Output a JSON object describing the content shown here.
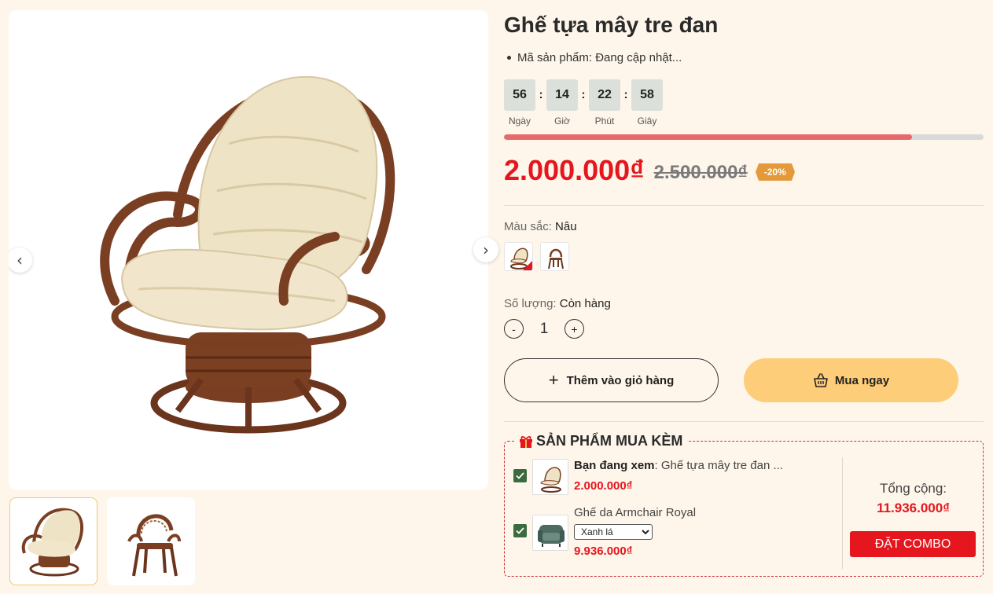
{
  "product": {
    "title": "Ghế tựa mây tre đan",
    "sku_label": "Mã sản phẩm:",
    "sku_value": "Đang cập nhật..."
  },
  "gallery": {
    "prev_icon": "chevron-left-icon",
    "next_icon": "chevron-right-icon",
    "main_image": "rattan-swivel-chair-with-cream-cushion",
    "thumbnails": [
      "rattan-swivel-chair-with-cream-cushion",
      "rattan-armchair-woven-back"
    ]
  },
  "countdown": {
    "units": [
      {
        "value": "56",
        "label": "Ngày"
      },
      {
        "value": "14",
        "label": "Giờ"
      },
      {
        "value": "22",
        "label": "Phút"
      },
      {
        "value": "58",
        "label": "Giây"
      }
    ],
    "separator": ":"
  },
  "sale_progress": 0.85,
  "price": {
    "current": "2.000.000₫",
    "original": "2.500.000₫",
    "discount": "-20%"
  },
  "color": {
    "label": "Màu sắc:",
    "value": "Nâu",
    "options": [
      "swivel-chair-swatch",
      "armchair-swatch"
    ]
  },
  "quantity": {
    "label": "Số lượng:",
    "status": "Còn hàng",
    "minus": "-",
    "value": "1",
    "plus": "+"
  },
  "actions": {
    "add_to_cart": "Thêm vào giỏ hàng",
    "add_to_cart_icon": "plus-icon",
    "buy_now": "Mua ngay",
    "buy_now_icon": "basket-icon"
  },
  "combo": {
    "title": "SẢN PHẨM MUA KÈM",
    "title_icon": "gift-icon",
    "items": [
      {
        "prefix": "Bạn đang xem",
        "name": ": Ghế tựa mây tre đan ...",
        "price": "2.000.000₫",
        "checked": true
      },
      {
        "name": "Ghế da Armchair Royal",
        "variant": "Xanh lá",
        "price": "9.936.000₫",
        "checked": true
      }
    ],
    "total_label": "Tổng cộng:",
    "total_value": "11.936.000₫",
    "order_button": "ĐẶT COMBO"
  },
  "colors": {
    "background": "#fef6ea",
    "price_red": "#e5161d",
    "progress_fill": "#e8696b",
    "buy_button": "#fecd79",
    "checkbox_green": "#3b6a3f",
    "discount_tag": "#e49a3a"
  }
}
